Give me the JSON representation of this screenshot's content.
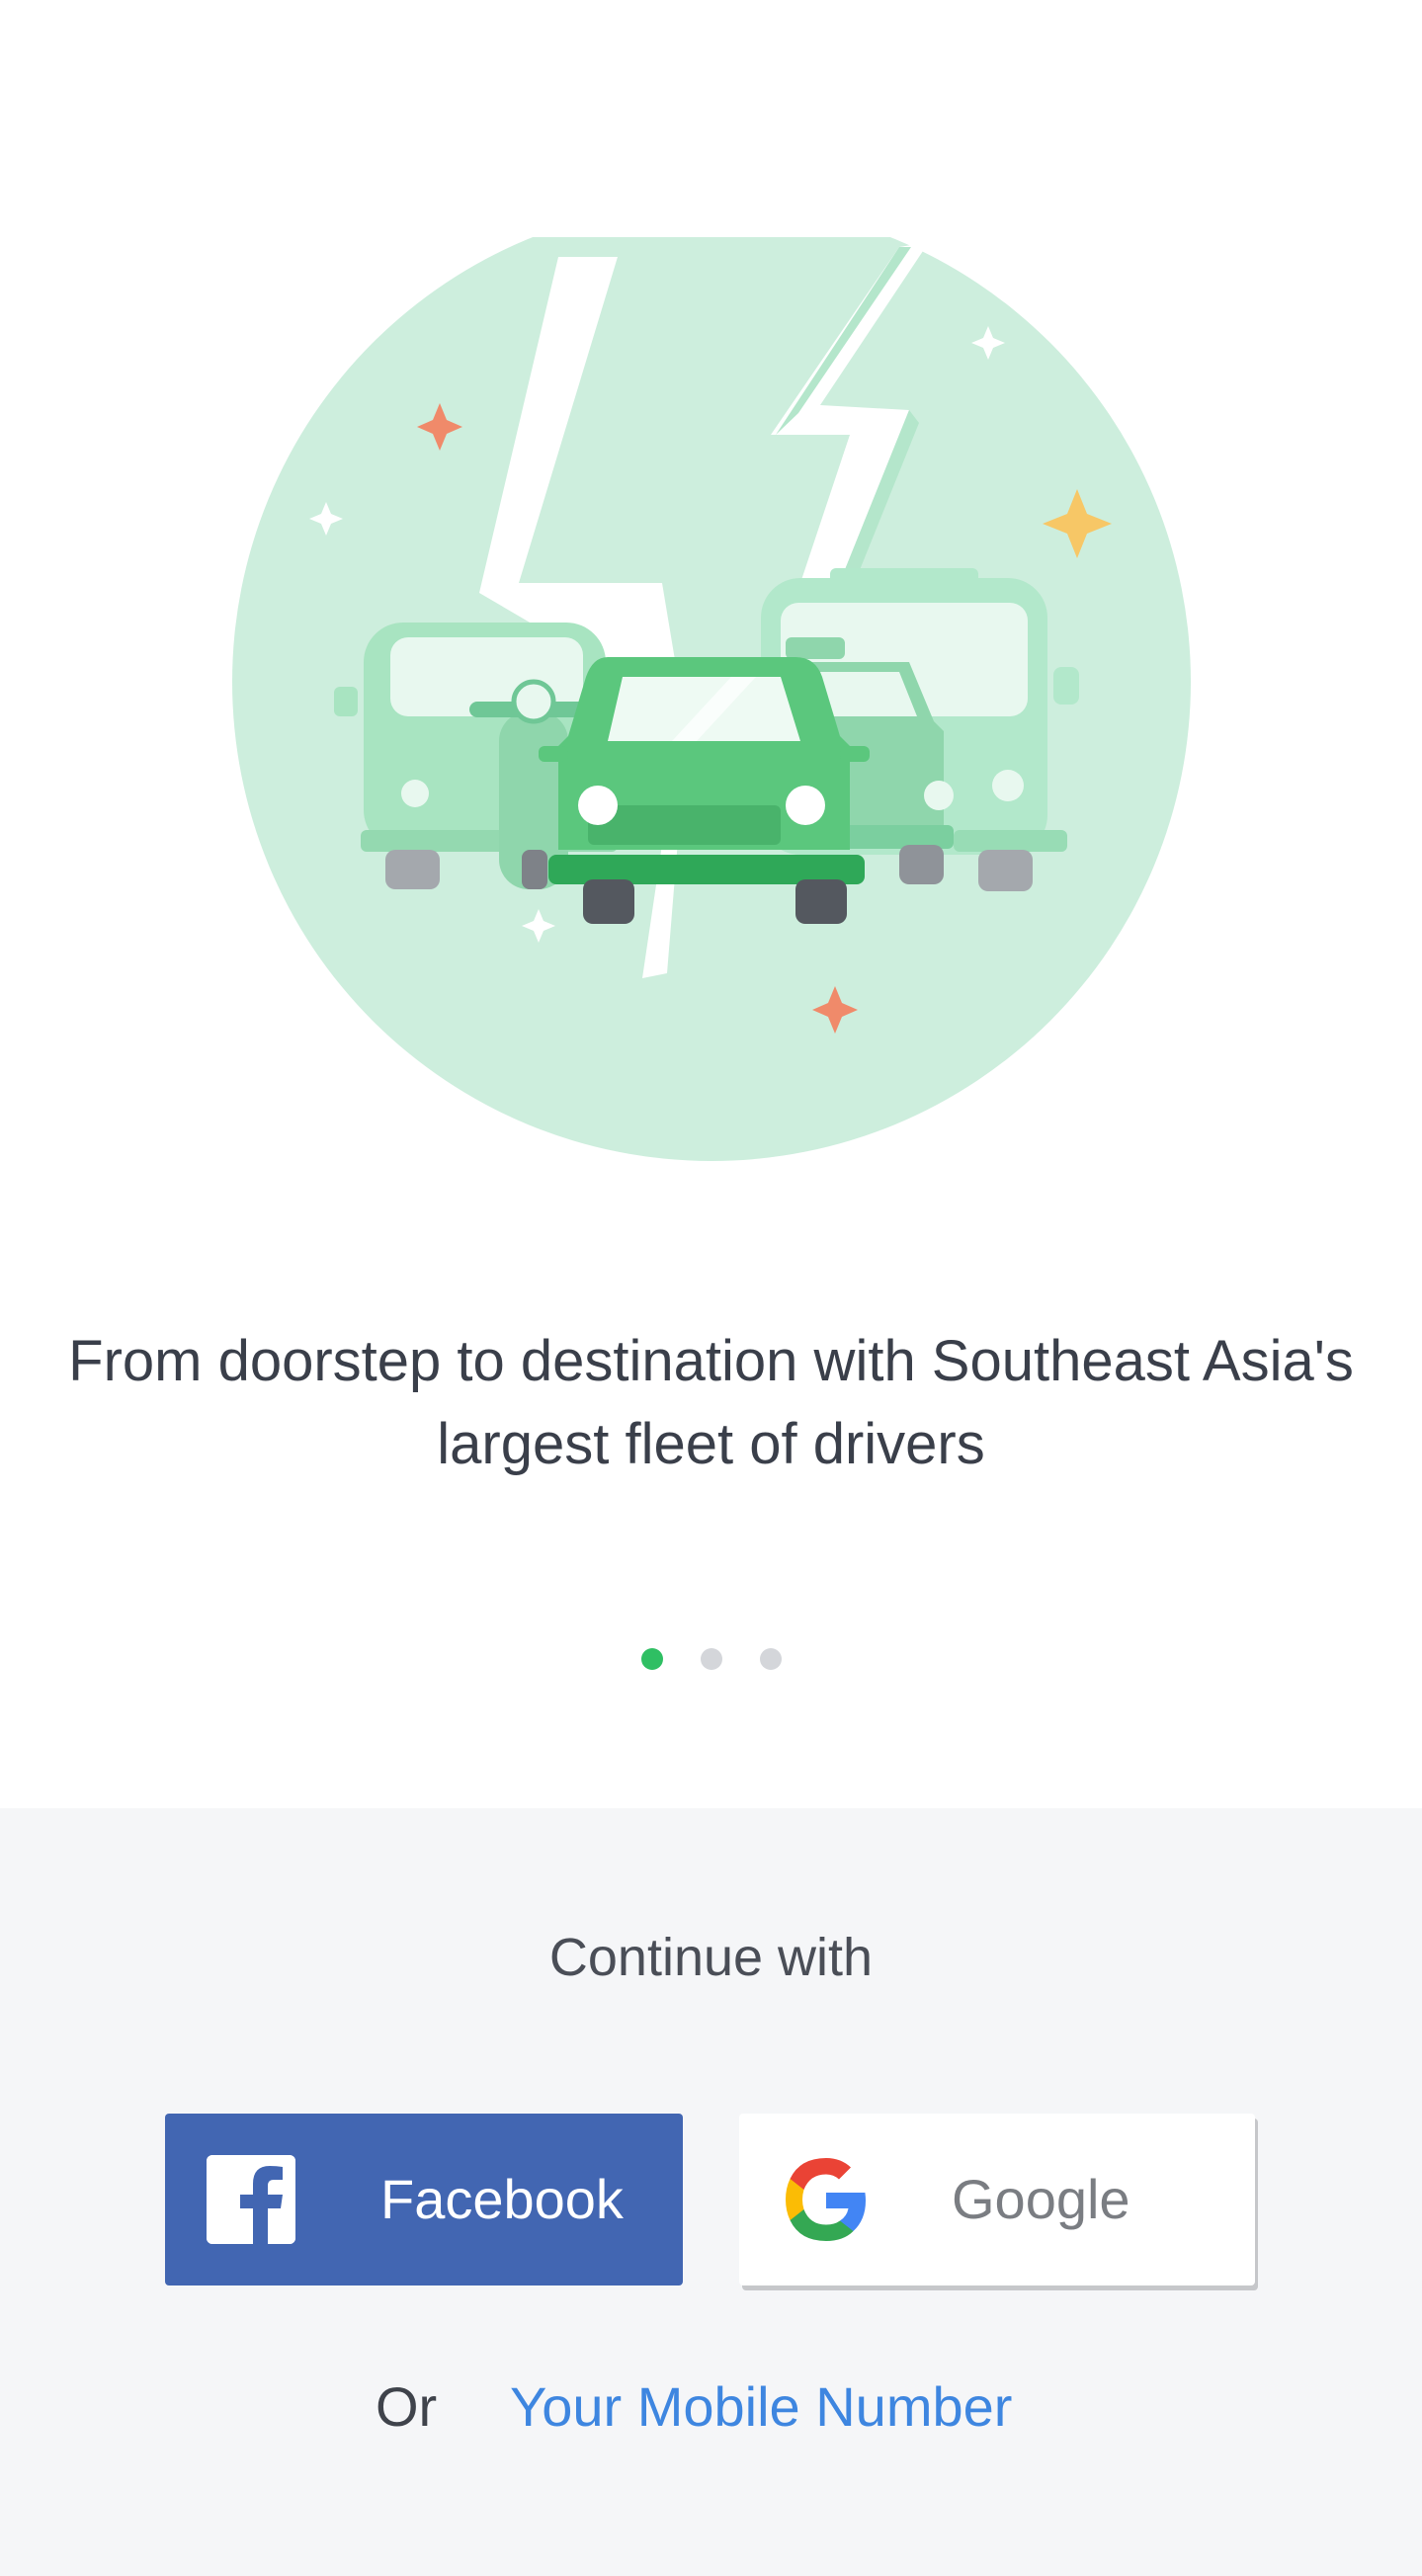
{
  "onboarding": {
    "headline": "From doorstep to destination with Southeast Asia's largest fleet of drivers",
    "pager": {
      "total": 3,
      "active_index": 0
    }
  },
  "login": {
    "continue_label": "Continue with",
    "facebook_label": "Facebook",
    "google_label": "Google",
    "or_label": "Or",
    "mobile_link_label": "Your Mobile Number"
  },
  "colors": {
    "brand_green": "#2fbf63",
    "facebook_blue": "#4266b2",
    "link_blue": "#3e86e0",
    "panel_bg": "#f5f6f8"
  },
  "icons": {
    "illustration": "vehicles-fleet-illustration",
    "facebook": "facebook-icon",
    "google": "google-icon"
  }
}
